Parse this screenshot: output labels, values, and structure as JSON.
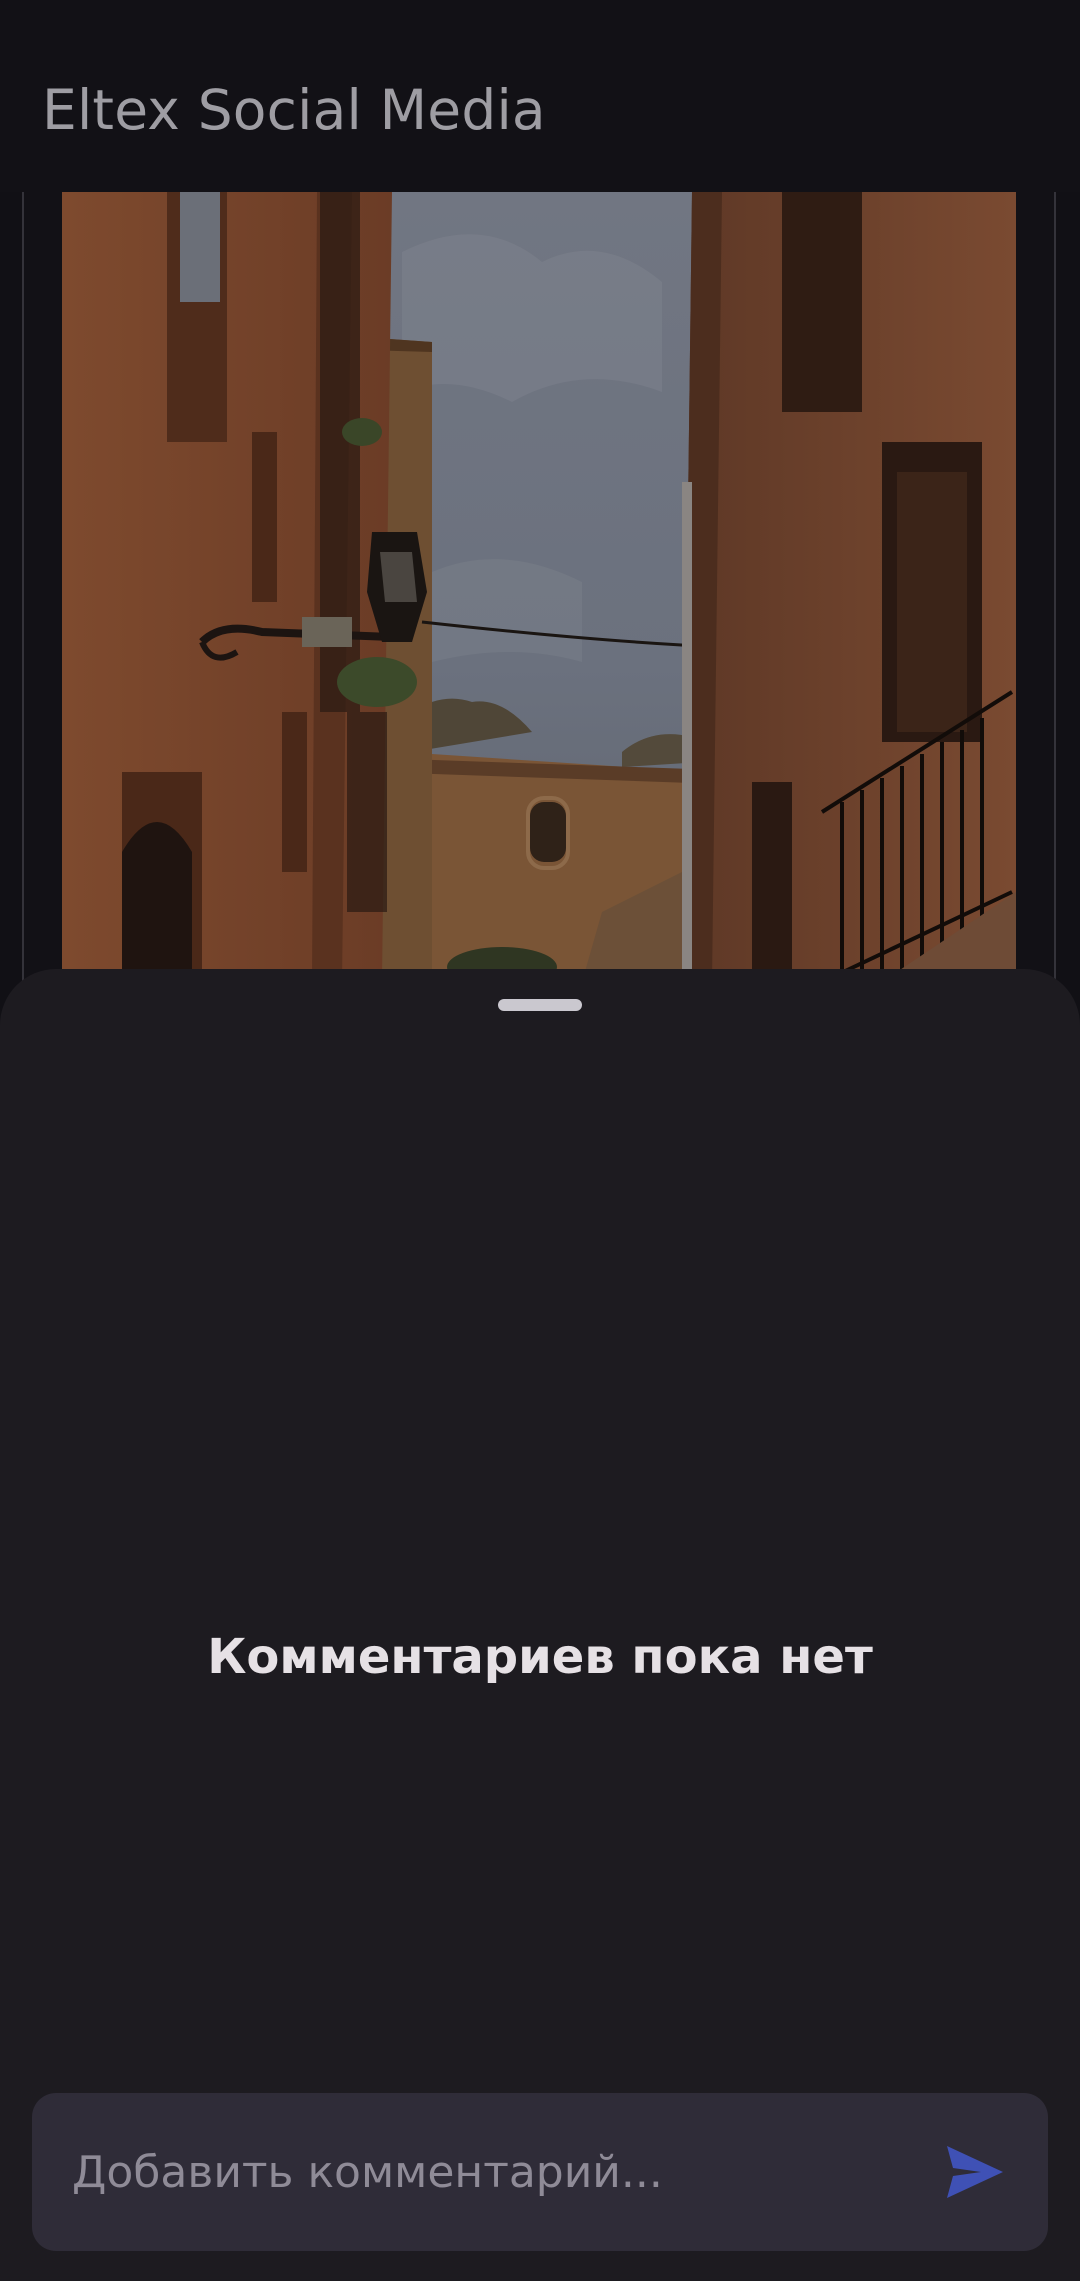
{
  "appbar": {
    "title": "Eltex Social Media"
  },
  "post": {
    "image_alt": "photo"
  },
  "comments_sheet": {
    "empty_text": "Комментариев пока нет",
    "input": {
      "value": "",
      "placeholder": "Добавить комментарий..."
    },
    "send_icon": "send-icon"
  },
  "colors": {
    "accent": "#3f51b5",
    "sheet_background": "#1d1b20",
    "input_background": "#2f2c38"
  }
}
